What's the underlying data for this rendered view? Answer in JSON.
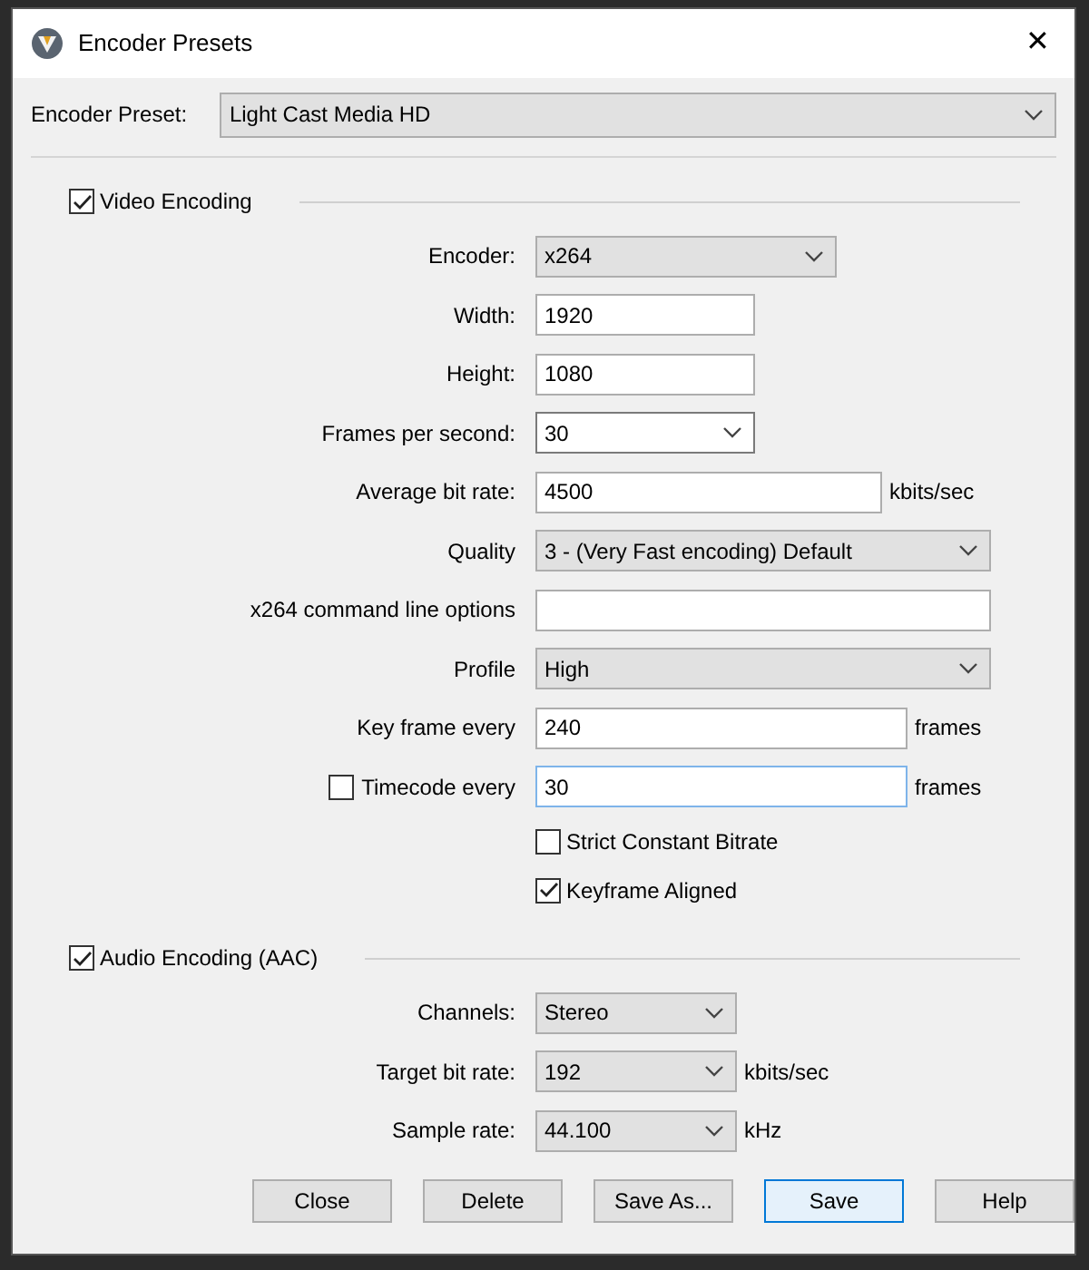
{
  "window": {
    "title": "Encoder Presets",
    "close": "✕"
  },
  "preset": {
    "label": "Encoder Preset:",
    "value": "Light Cast Media HD"
  },
  "video": {
    "label": "Video Encoding",
    "checked": true,
    "rows": [
      {
        "kind": "dropdown",
        "label": "Encoder:",
        "value": "x264"
      },
      {
        "kind": "text",
        "label": "Width:",
        "value": "1920",
        "focused": false
      },
      {
        "kind": "text",
        "label": "Height:",
        "value": "1080",
        "focused": false
      },
      {
        "kind": "combo",
        "label": "Frames per second:",
        "value": "30"
      },
      {
        "kind": "text",
        "label": "Average bit rate:",
        "value": "4500",
        "unit": "kbits/sec",
        "focused": false
      },
      {
        "kind": "dropdown",
        "label": "Quality",
        "value": "3 - (Very Fast encoding) Default"
      },
      {
        "kind": "text",
        "label": "x264 command line options",
        "focused": false
      },
      {
        "kind": "dropdown",
        "label": "Profile",
        "value": "High"
      },
      {
        "kind": "text",
        "label": "Key frame every",
        "value": "240",
        "unit": "frames",
        "focused": false
      },
      {
        "kind": "checktext",
        "label": "Timecode every",
        "checked": false,
        "value": "30",
        "unit": "frames",
        "focused": true
      },
      {
        "kind": "checkbox",
        "label": "Strict Constant Bitrate",
        "checked": false
      },
      {
        "kind": "checkbox",
        "label": "Keyframe Aligned",
        "checked": true
      }
    ]
  },
  "audio": {
    "label": "Audio Encoding (AAC)",
    "checked": true,
    "rows": [
      {
        "kind": "dropdown",
        "label": "Channels:",
        "value": "Stereo"
      },
      {
        "kind": "dropdown",
        "label": "Target bit rate:",
        "value": "192",
        "unit": "kbits/sec"
      },
      {
        "kind": "dropdown",
        "label": "Sample rate:",
        "value": "44.100",
        "unit": "kHz"
      }
    ]
  },
  "buttons": [
    {
      "label": "Close",
      "default": false
    },
    {
      "label": "Delete",
      "default": false
    },
    {
      "label": "Save As...",
      "default": false
    },
    {
      "label": "Save",
      "default": true
    },
    {
      "label": "Help",
      "default": false
    }
  ]
}
